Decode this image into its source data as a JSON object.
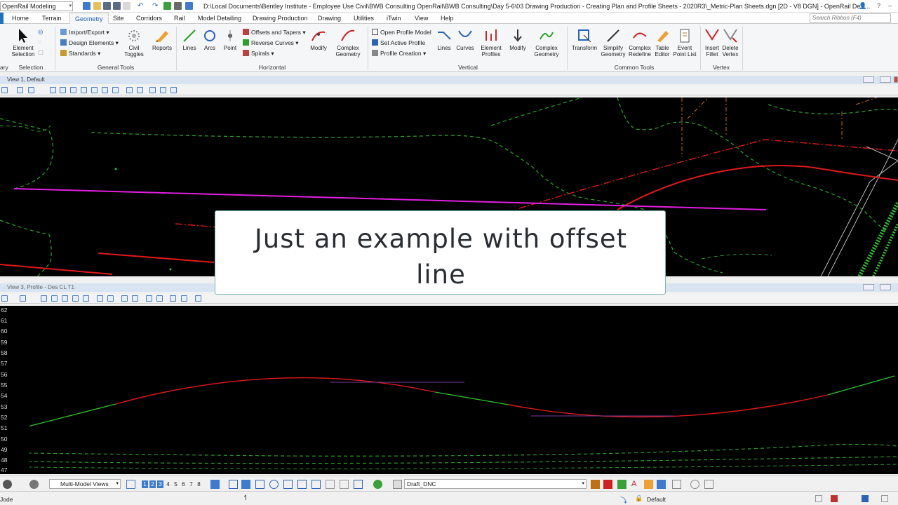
{
  "titlebar": {
    "workflow": "OpenRail Modeling",
    "document_title": "D:\\Local Documents\\Bentley Institute - Employee Use Civil\\BWB Consulting OpenRail\\BWB Consulting\\Day 5-6\\03 Drawing Production - Creating Plan and Profile Sheets - 2020R3\\_Metric-Plan Sheets.dgn [2D - V8 DGN] - OpenRail Desi...",
    "search_placeholder": "Search Ribbon (F4)",
    "help": "?"
  },
  "tabs": [
    "Home",
    "Terrain",
    "Geometry",
    "Site",
    "Corridors",
    "Rail",
    "Model Detailing",
    "Drawing Production",
    "Drawing",
    "Utilities",
    "iTwin",
    "View",
    "Help"
  ],
  "active_tab": "Geometry",
  "ribbon": {
    "selection": {
      "label": "Selection",
      "element_selection": "Element Selection",
      "left_cut": "ary"
    },
    "general_tools": {
      "label": "General Tools",
      "import_export": "Import/Export",
      "design_elements": "Design Elements",
      "standards": "Standards",
      "civil_toggles": "Civil Toggles",
      "reports": "Reports"
    },
    "horizontal": {
      "label": "Horizontal",
      "lines": "Lines",
      "arcs": "Arcs",
      "point": "Point",
      "offsets_tapers": "Offsets and Tapers",
      "reverse_curves": "Reverse Curves",
      "spirals": "Spirals",
      "modify": "Modify",
      "complex_geometry": "Complex Geometry"
    },
    "vertical": {
      "label": "Vertical",
      "open_profile_model": "Open Profile Model",
      "set_active_profile": "Set Active Profile",
      "profile_creation": "Profile Creation",
      "lines": "Lines",
      "curves": "Curves",
      "element_profiles": "Element Profiles",
      "modify": "Modify",
      "complex_geometry": "Complex Geometry"
    },
    "common_tools": {
      "label": "Common Tools",
      "transform": "Transform",
      "simplify_geometry": "Simplify Geometry",
      "complex_redefine": "Complex Redefine",
      "table_editor": "Table Editor",
      "event_point_list": "Event Point List"
    },
    "vertex": {
      "label": "Vertex",
      "insert_fillet": "Insert Fillet",
      "delete_vertex": "Delete Vertex"
    }
  },
  "view1": {
    "title": "View 1, Default"
  },
  "view3": {
    "title": "View 3, Profile - Des CL T1",
    "ticks": [
      "62",
      "61",
      "60",
      "59",
      "58",
      "57",
      "56",
      "55",
      "54",
      "53",
      "52",
      "51",
      "50",
      "49",
      "48",
      "47"
    ]
  },
  "caption": {
    "line1": "Just an example with offset",
    "line2": "line"
  },
  "bottombar": {
    "view_selector": "Multi-Model Views",
    "view_numbers": [
      "1",
      "2",
      "3",
      "4",
      "5",
      "6",
      "7",
      "8"
    ],
    "active_level": "Draft_DNC"
  },
  "status": {
    "mode": "Jode",
    "model": "Default"
  },
  "colors": {
    "tab_active": "#1e5fb4",
    "offset_line": "#e020e0",
    "alignment_red": "#e01818",
    "tangent_green": "#2ec02e",
    "contour_green": "#2a9a2a",
    "caption_border": "#7ab8b0"
  }
}
